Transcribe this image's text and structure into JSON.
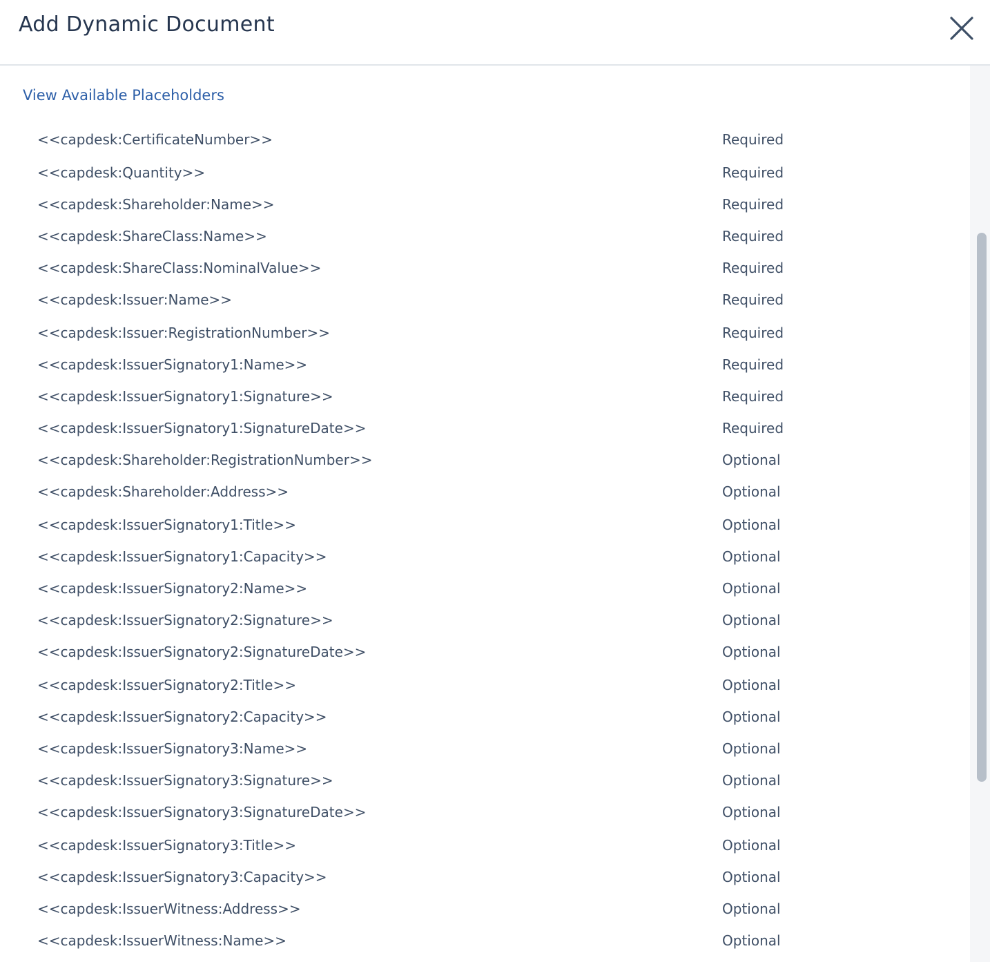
{
  "dialog": {
    "title": "Add Dynamic Document",
    "close_icon": "close-icon",
    "link_label": "View Available Placeholders"
  },
  "placeholders": [
    {
      "name": "<<capdesk:CertificateNumber>>",
      "status": "Required"
    },
    {
      "name": "<<capdesk:Quantity>>",
      "status": "Required"
    },
    {
      "name": "<<capdesk:Shareholder:Name>>",
      "status": "Required"
    },
    {
      "name": "<<capdesk:ShareClass:Name>>",
      "status": "Required"
    },
    {
      "name": "<<capdesk:ShareClass:NominalValue>>",
      "status": "Required"
    },
    {
      "name": "<<capdesk:Issuer:Name>>",
      "status": "Required"
    },
    {
      "name": "<<capdesk:Issuer:RegistrationNumber>>",
      "status": "Required"
    },
    {
      "name": "<<capdesk:IssuerSignatory1:Name>>",
      "status": "Required"
    },
    {
      "name": "<<capdesk:IssuerSignatory1:Signature>>",
      "status": "Required"
    },
    {
      "name": "<<capdesk:IssuerSignatory1:SignatureDate>>",
      "status": "Required"
    },
    {
      "name": "<<capdesk:Shareholder:RegistrationNumber>>",
      "status": "Optional"
    },
    {
      "name": "<<capdesk:Shareholder:Address>>",
      "status": "Optional"
    },
    {
      "name": "<<capdesk:IssuerSignatory1:Title>>",
      "status": "Optional"
    },
    {
      "name": "<<capdesk:IssuerSignatory1:Capacity>>",
      "status": "Optional"
    },
    {
      "name": "<<capdesk:IssuerSignatory2:Name>>",
      "status": "Optional"
    },
    {
      "name": "<<capdesk:IssuerSignatory2:Signature>>",
      "status": "Optional"
    },
    {
      "name": "<<capdesk:IssuerSignatory2:SignatureDate>>",
      "status": "Optional"
    },
    {
      "name": "<<capdesk:IssuerSignatory2:Title>>",
      "status": "Optional"
    },
    {
      "name": "<<capdesk:IssuerSignatory2:Capacity>>",
      "status": "Optional"
    },
    {
      "name": "<<capdesk:IssuerSignatory3:Name>>",
      "status": "Optional"
    },
    {
      "name": "<<capdesk:IssuerSignatory3:Signature>>",
      "status": "Optional"
    },
    {
      "name": "<<capdesk:IssuerSignatory3:SignatureDate>>",
      "status": "Optional"
    },
    {
      "name": "<<capdesk:IssuerSignatory3:Title>>",
      "status": "Optional"
    },
    {
      "name": "<<capdesk:IssuerSignatory3:Capacity>>",
      "status": "Optional"
    },
    {
      "name": "<<capdesk:IssuerWitness:Address>>",
      "status": "Optional"
    },
    {
      "name": "<<capdesk:IssuerWitness:Name>>",
      "status": "Optional"
    }
  ],
  "scrollbar": {
    "position_fraction": 0.19,
    "visible_fraction": 0.61
  }
}
